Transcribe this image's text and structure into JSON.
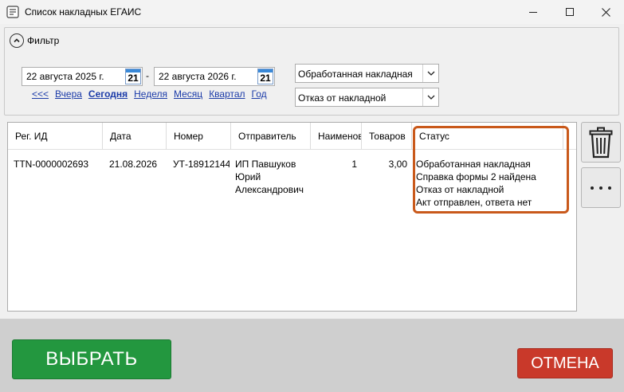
{
  "window": {
    "title": "Список накладных ЕГАИС"
  },
  "filter": {
    "label": "Фильтр",
    "date_from": "22 августа 2025 г.",
    "date_to": "22 августа 2026 г.",
    "calendar_day": "21",
    "separator": "-",
    "quick_links": [
      "<<<",
      "Вчера",
      "Сегодня",
      "Неделя",
      "Месяц",
      "Квартал",
      "Год"
    ],
    "status_select": "Обработанная накладная",
    "type_select": "Отказ от накладной"
  },
  "table": {
    "columns": [
      "Рег. ИД",
      "Дата",
      "Номер",
      "Отправитель",
      "Наименования",
      "Товаров",
      "Статус"
    ],
    "rows": [
      {
        "reg_id": "TTN-0000002693",
        "date": "21.08.2026",
        "number": "УТ-18912144",
        "sender": [
          "ИП Павшуков",
          "Юрий",
          "Александрович"
        ],
        "names": "1",
        "goods": "3,00",
        "status": [
          "Обработанная накладная",
          "Справка формы 2 найдена",
          "Отказ от накладной",
          "Акт отправлен, ответа нет"
        ]
      }
    ]
  },
  "buttons": {
    "select": "ВЫБРАТЬ",
    "cancel": "ОТМЕНА"
  },
  "colors": {
    "select_button": "#23973f",
    "cancel_button": "#c9392a",
    "highlight": "#c9591b",
    "link": "#1a3aa8"
  },
  "icons": {
    "trash": "trash-icon",
    "more": "more-dots-icon"
  }
}
